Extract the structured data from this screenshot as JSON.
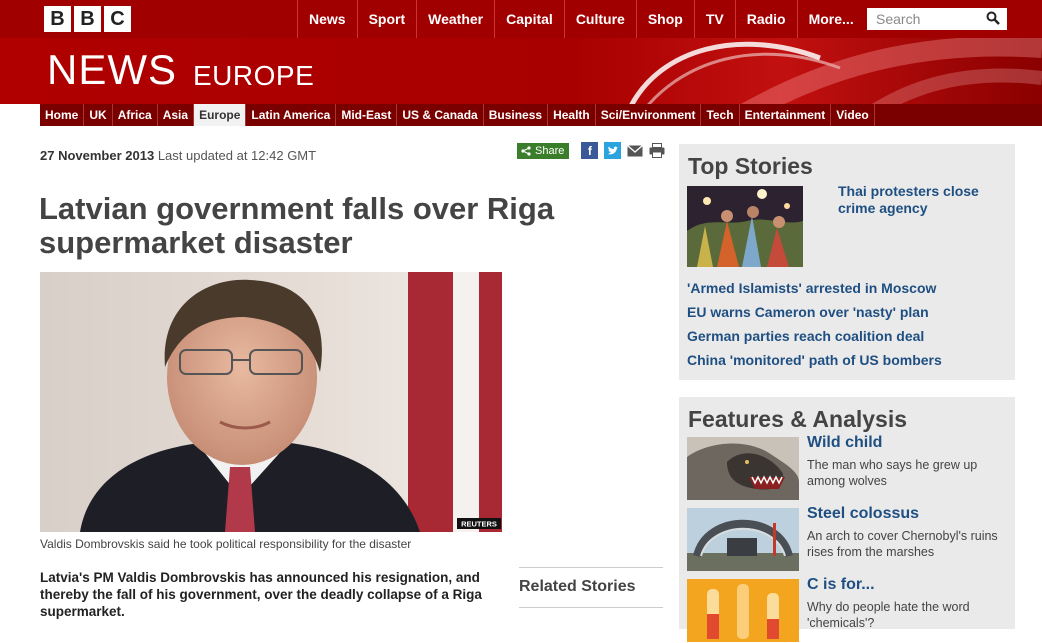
{
  "brand": {
    "letters": [
      "B",
      "B",
      "C"
    ],
    "site": "NEWS",
    "region": "EUROPE"
  },
  "topnav": [
    "News",
    "Sport",
    "Weather",
    "Capital",
    "Culture",
    "Shop",
    "TV",
    "Radio",
    "More..."
  ],
  "search": {
    "placeholder": "Search"
  },
  "secnav": [
    {
      "label": "Home"
    },
    {
      "label": "UK"
    },
    {
      "label": "Africa"
    },
    {
      "label": "Asia"
    },
    {
      "label": "Europe",
      "active": true
    },
    {
      "label": "Latin America"
    },
    {
      "label": "Mid-East"
    },
    {
      "label": "US & Canada"
    },
    {
      "label": "Business"
    },
    {
      "label": "Health"
    },
    {
      "label": "Sci/Environment"
    },
    {
      "label": "Tech"
    },
    {
      "label": "Entertainment"
    },
    {
      "label": "Video"
    }
  ],
  "article": {
    "date": "27 November 2013",
    "updated": "Last updated at 12:42 GMT",
    "share_label": "Share",
    "headline": "Latvian government falls over Riga supermarket disaster",
    "photo_credit": "REUTERS",
    "caption": "Valdis Dombrovskis said he took political responsibility for the disaster",
    "intro": "Latvia's PM Valdis Dombrovskis has announced his resignation, and thereby the fall of his government, over the deadly collapse of a Riga supermarket.",
    "related_heading": "Related Stories"
  },
  "top_stories": {
    "heading": "Top Stories",
    "lead": "Thai protesters close crime agency",
    "links": [
      "'Armed Islamists' arrested in Moscow",
      "EU warns Cameron over 'nasty' plan",
      "German parties reach coalition deal",
      "China 'monitored' path of US bombers"
    ]
  },
  "features": {
    "heading": "Features & Analysis",
    "items": [
      {
        "title": "Wild child",
        "desc": "The man who says he grew up among wolves"
      },
      {
        "title": "Steel colossus",
        "desc": "An arch to cover Chernobyl's ruins rises from the marshes"
      },
      {
        "title": "C is for...",
        "desc": "Why do people hate the word 'chemicals'?"
      }
    ]
  },
  "colors": {
    "brand_red": "#a00000",
    "link_blue": "#1f4f82",
    "share_green": "#3a7d2a"
  }
}
